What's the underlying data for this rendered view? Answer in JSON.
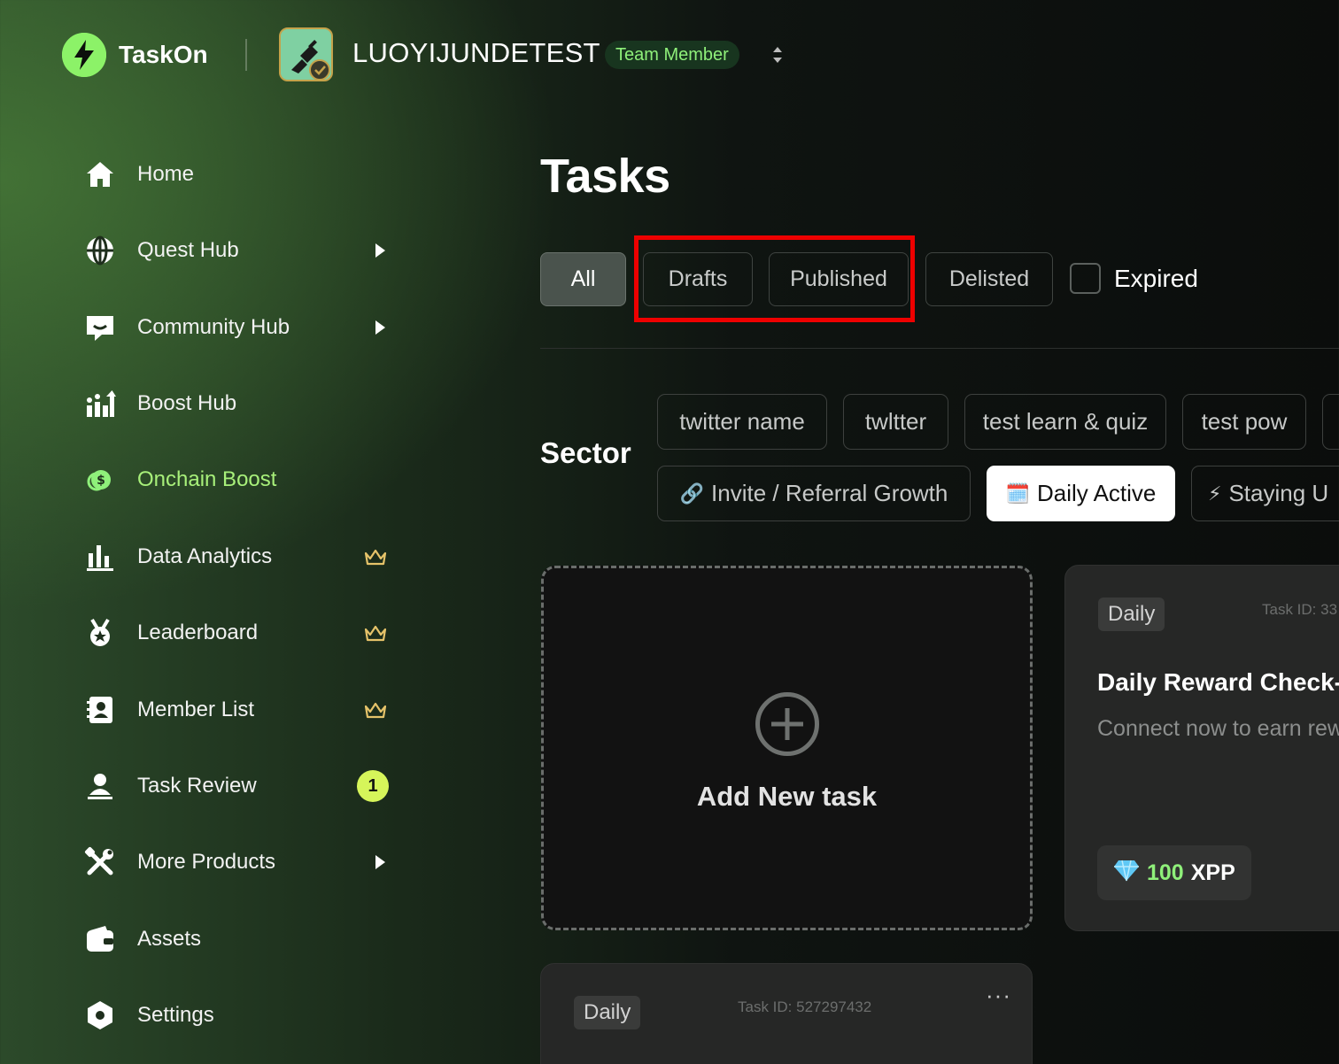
{
  "header": {
    "app_name": "TaskOn",
    "project_name": "LUOYIJUNDETEST",
    "role_badge": "Team Member"
  },
  "sidebar": {
    "items": [
      {
        "label": "Home",
        "icon": "home-icon"
      },
      {
        "label": "Quest Hub",
        "icon": "globe-icon",
        "has_submenu": true
      },
      {
        "label": "Community Hub",
        "icon": "chat-icon",
        "has_submenu": true
      },
      {
        "label": "Boost Hub",
        "icon": "growth-icon"
      },
      {
        "label": "Onchain Boost",
        "icon": "coin-icon",
        "active": true
      },
      {
        "label": "Data Analytics",
        "icon": "bar-chart-icon",
        "premium": true
      },
      {
        "label": "Leaderboard",
        "icon": "medal-icon",
        "premium": true
      },
      {
        "label": "Member List",
        "icon": "contacts-icon",
        "premium": true
      },
      {
        "label": "Task Review",
        "icon": "user-icon",
        "count": "1"
      },
      {
        "label": "More Products",
        "icon": "tools-icon",
        "has_submenu": true
      },
      {
        "label": "Assets",
        "icon": "wallet-icon"
      },
      {
        "label": "Settings",
        "icon": "settings-icon"
      }
    ]
  },
  "main": {
    "title": "Tasks",
    "filters": {
      "all": "All",
      "drafts": "Drafts",
      "published": "Published",
      "delisted": "Delisted",
      "expired": "Expired"
    },
    "sector": {
      "label": "Sector",
      "row1": [
        "twitter name",
        "twltter",
        "test learn & quiz",
        "test pow"
      ],
      "row2": [
        {
          "emoji": "🔗",
          "label": "Invite / Referral Growth"
        },
        {
          "emoji": "🗓️",
          "label": "Daily Active",
          "selected": true
        },
        {
          "emoji": "⚡",
          "label": "Staying U"
        }
      ]
    },
    "add_card": {
      "label": "Add New task"
    },
    "cards": [
      {
        "tag": "Daily",
        "task_id": "Task ID: 33",
        "title": "Daily Reward Check-",
        "description": "Connect now to earn rew",
        "reward_amount": "100",
        "reward_unit": "XPP"
      },
      {
        "tag": "Daily",
        "task_id": "Task ID: 527297432",
        "more": "···"
      }
    ]
  },
  "colors": {
    "accent_green": "#8ff07a",
    "highlight_red": "#ee0000",
    "count_badge": "#d6f55a"
  }
}
